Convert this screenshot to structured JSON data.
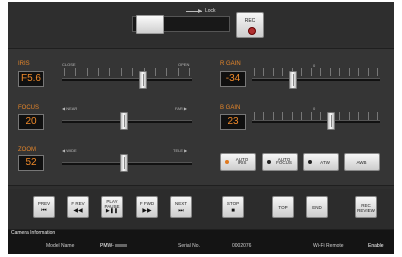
{
  "lock": {
    "label": "Lock"
  },
  "rec": {
    "label": "REC"
  },
  "iris": {
    "label": "IRIS",
    "value": "F5.6",
    "min_label": "CLOSE",
    "max_label": "OPEN",
    "level": 0.62
  },
  "focus": {
    "label": "FOCUS",
    "value": "20",
    "min_label": "◀ NEAR",
    "max_label": "FAR ▶",
    "level": 0.48
  },
  "zoom": {
    "label": "ZOOM",
    "value": "52",
    "min_label": "◀ WIDE",
    "max_label": "TELE ▶",
    "level": 0.48
  },
  "rgain": {
    "label": "R GAIN",
    "value": "-34",
    "center_label": "0",
    "level": 0.32
  },
  "bgain": {
    "label": "B GAIN",
    "value": "23",
    "center_label": "0",
    "level": 0.62
  },
  "modes": [
    {
      "label1": "AUTO",
      "label2": "IRIS",
      "dot_color": "#e07a20",
      "active": true
    },
    {
      "label1": "AUTO",
      "label2": "FOCUS",
      "dot_color": "#222222",
      "active": false
    },
    {
      "label1": "ATW",
      "label2": "",
      "dot_color": "#222222",
      "active": false
    },
    {
      "label1": "AWB",
      "label2": "",
      "dot_color": "",
      "active": false
    }
  ],
  "transport": [
    {
      "label": "PREV",
      "icon": "⏮"
    },
    {
      "label": "F REV",
      "icon": "◀◀"
    },
    {
      "label": "PLAY\nPAUSE",
      "icon": "▶❚❚"
    },
    {
      "label": "F FWD",
      "icon": "▶▶"
    },
    {
      "label": "NEXT",
      "icon": "⏭"
    },
    {
      "label": "STOP",
      "icon": "■"
    },
    {
      "label": "TOP",
      "icon": ""
    },
    {
      "label": "END",
      "icon": ""
    },
    {
      "label": "REC\nREVIEW",
      "icon": ""
    }
  ],
  "camera_info": {
    "title": "Camera Information",
    "model_label": "Model Name",
    "model_value": "PMW-",
    "serial_label": "Serial No.",
    "serial_value": "0002076",
    "wifi_label": "Wi-Fi Remote",
    "wifi_value": "Enable"
  },
  "colors": {
    "accent": "#e6862a",
    "value_text": "#f08a2a",
    "rec_dot": "#b03030"
  }
}
